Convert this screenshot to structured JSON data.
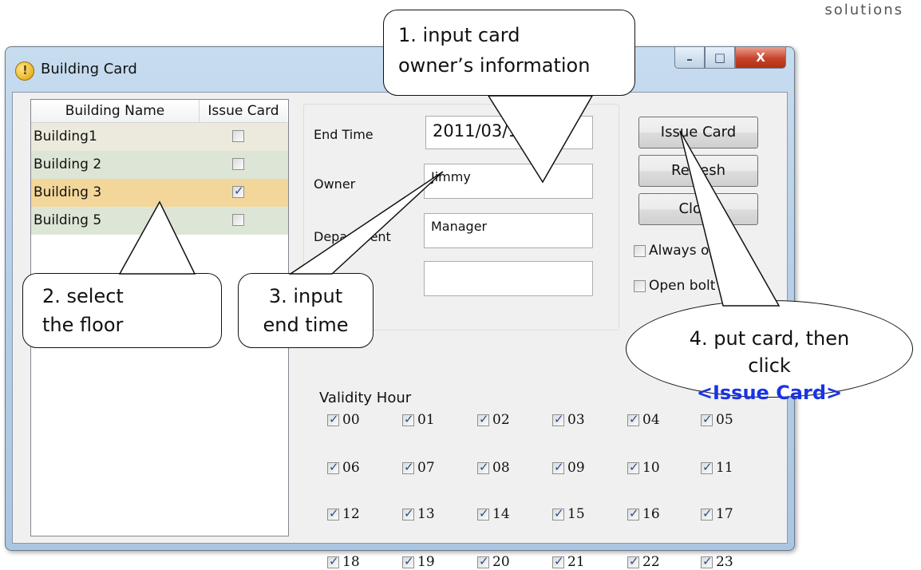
{
  "brand": "solutions",
  "window": {
    "title": "Building Card",
    "caption_buttons": {
      "minimize": "–",
      "maximize": "□",
      "close": "X"
    }
  },
  "list": {
    "columns": [
      "Building Name",
      "Issue Card"
    ],
    "rows": [
      {
        "name": "Building1",
        "checked": false
      },
      {
        "name": "Building 2",
        "checked": false
      },
      {
        "name": "Building 3",
        "checked": true
      },
      {
        "name": "Building 5",
        "checked": false
      }
    ]
  },
  "form": {
    "end_time_label": "End Time",
    "end_time_value": "2011/03/15",
    "owner_label": "Owner",
    "owner_value": "Jimmy",
    "department_label": "Department",
    "department_value": "Manager",
    "extra_value": ""
  },
  "buttons": {
    "issue": "Issue Card",
    "refresh": "Refresh",
    "close": "Close"
  },
  "options": {
    "always": "Always open",
    "open_bolt": "Open bolt"
  },
  "validity": {
    "label": "Validity Hour",
    "hours": [
      "00",
      "01",
      "02",
      "03",
      "04",
      "05",
      "06",
      "07",
      "08",
      "09",
      "10",
      "11",
      "12",
      "13",
      "14",
      "15",
      "16",
      "17",
      "18",
      "19",
      "20",
      "21",
      "22",
      "23"
    ]
  },
  "callouts": {
    "c1": [
      "1. input card",
      "owner’s information"
    ],
    "c2": [
      "2. select",
      "the floor"
    ],
    "c3": [
      "3. input",
      "end time"
    ],
    "c4_line1": "4. put card, then",
    "c4_prefix": "click",
    "c4_highlight": "<Issue Card>"
  },
  "colors": {
    "row_selected": "#f3d79a",
    "highlight_text": "#1a33e6",
    "close_button": "#c7432b"
  }
}
